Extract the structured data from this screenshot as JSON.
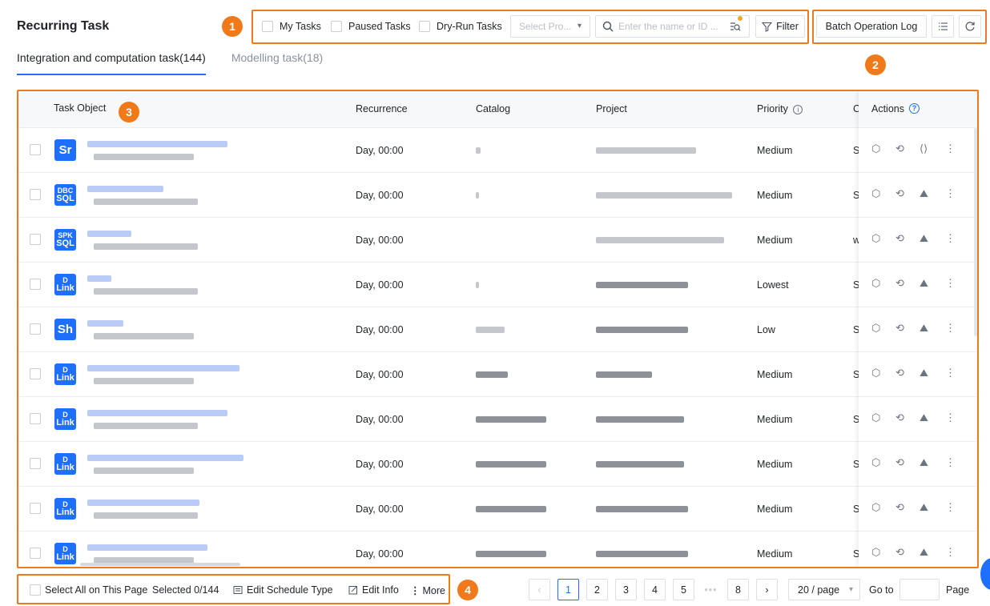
{
  "header": {
    "title": "Recurring Task",
    "filters": {
      "my_tasks": "My Tasks",
      "paused_tasks": "Paused Tasks",
      "dry_run_tasks": "Dry-Run Tasks",
      "project_select_placeholder": "Select Pro...",
      "search_placeholder": "Enter the name or ID ...",
      "filter_button": "Filter"
    },
    "batch_log_button": "Batch Operation Log"
  },
  "callouts": [
    "1",
    "2",
    "3",
    "4"
  ],
  "tabs": [
    {
      "label": "Integration and computation task(144)",
      "active": true
    },
    {
      "label": "Modelling task(18)",
      "active": false
    }
  ],
  "table": {
    "columns": {
      "task_object": "Task Object",
      "recurrence": "Recurrence",
      "catalog": "Catalog",
      "project": "Project",
      "priority": "Priority",
      "owner_partial": "C",
      "actions": "Actions"
    },
    "rows": [
      {
        "icon": "Sr",
        "icon_top": "",
        "recurrence": "Day, 00:00",
        "priority": "Medium",
        "extra": "S"
      },
      {
        "icon": "SQL",
        "icon_top": "DBC",
        "recurrence": "Day, 00:00",
        "priority": "Medium",
        "extra": "S"
      },
      {
        "icon": "SQL",
        "icon_top": "SPK",
        "recurrence": "Day, 00:00",
        "priority": "Medium",
        "extra": "w"
      },
      {
        "icon": "Link",
        "icon_top": "D",
        "recurrence": "Day, 00:00",
        "priority": "Lowest",
        "extra": "S"
      },
      {
        "icon": "Sh",
        "icon_top": "",
        "recurrence": "Day, 00:00",
        "priority": "Low",
        "extra": "S"
      },
      {
        "icon": "Link",
        "icon_top": "D",
        "recurrence": "Day, 00:00",
        "priority": "Medium",
        "extra": "S"
      },
      {
        "icon": "Link",
        "icon_top": "D",
        "recurrence": "Day, 00:00",
        "priority": "Medium",
        "extra": "S"
      },
      {
        "icon": "Link",
        "icon_top": "D",
        "recurrence": "Day, 00:00",
        "priority": "Medium",
        "extra": "S"
      },
      {
        "icon": "Link",
        "icon_top": "D",
        "recurrence": "Day, 00:00",
        "priority": "Medium",
        "extra": "S"
      },
      {
        "icon": "Link",
        "icon_top": "D",
        "recurrence": "Day, 00:00",
        "priority": "Medium",
        "extra": "S"
      }
    ]
  },
  "footer": {
    "select_all": "Select All on This Page",
    "selected": "Selected 0/144",
    "edit_schedule": "Edit Schedule Type",
    "edit_info": "Edit Info",
    "more": "More",
    "pages": [
      "1",
      "2",
      "3",
      "4",
      "5",
      "8"
    ],
    "current_page": "1",
    "ellipsis": "•••",
    "page_size": "20 / page",
    "go_to": "Go to",
    "page_label": "Page"
  },
  "colors": {
    "accent": "#1f6fff",
    "callout": "#f07a1a"
  }
}
